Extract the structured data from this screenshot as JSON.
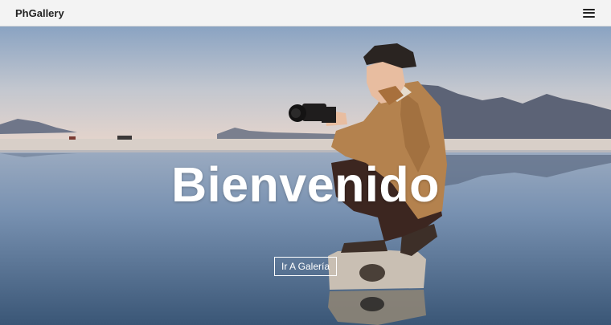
{
  "navbar": {
    "brand": "PhGallery",
    "menu_icon": "hamburger-menu-icon"
  },
  "hero": {
    "title": "Bienvenido",
    "cta_label": "Ir A Galería"
  },
  "colors": {
    "sky_top": "#8aa3c2",
    "sky_horizon": "#e4d4cc",
    "mountains": "#5c6376",
    "water_top": "#8ea3be",
    "water_bottom": "#3a5676",
    "jacket": "#b4824e",
    "pants": "#3c2620"
  }
}
